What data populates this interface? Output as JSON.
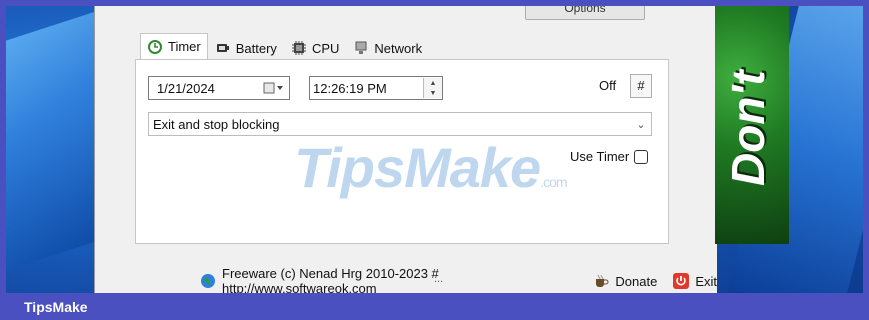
{
  "window": {
    "options_button_label": "Options",
    "tabs": [
      {
        "label": "Timer",
        "icon": "clock-icon",
        "active": true
      },
      {
        "label": "Battery",
        "icon": "battery-icon",
        "active": false
      },
      {
        "label": "CPU",
        "icon": "cpu-icon",
        "active": false
      },
      {
        "label": "Network",
        "icon": "network-icon",
        "active": false
      }
    ],
    "timer": {
      "date_value": "1/21/2024",
      "time_value": "12:26:19 PM",
      "status_label": "Off",
      "hash_button_label": "#",
      "action_selected": "Exit and stop blocking",
      "use_timer_label": "Use Timer",
      "use_timer_checked": false,
      "more_label": "..."
    },
    "footer": {
      "credit_text": "Freeware (c) Nenad Hrg 2010-2023 # http://www.softwareok.com",
      "donate_label": "Donate",
      "exit_label": "Exit"
    }
  },
  "ad": {
    "text": "Don't"
  },
  "watermark": {
    "text": "TipsMake",
    "suffix": ".com"
  },
  "bottom_bar": {
    "brand": "TipsMake"
  },
  "colors": {
    "frame": "#4a50c0",
    "window_bg": "#f0f0f0",
    "ad_green": "#1f7a22",
    "accent_blue": "#1b5fbf"
  }
}
